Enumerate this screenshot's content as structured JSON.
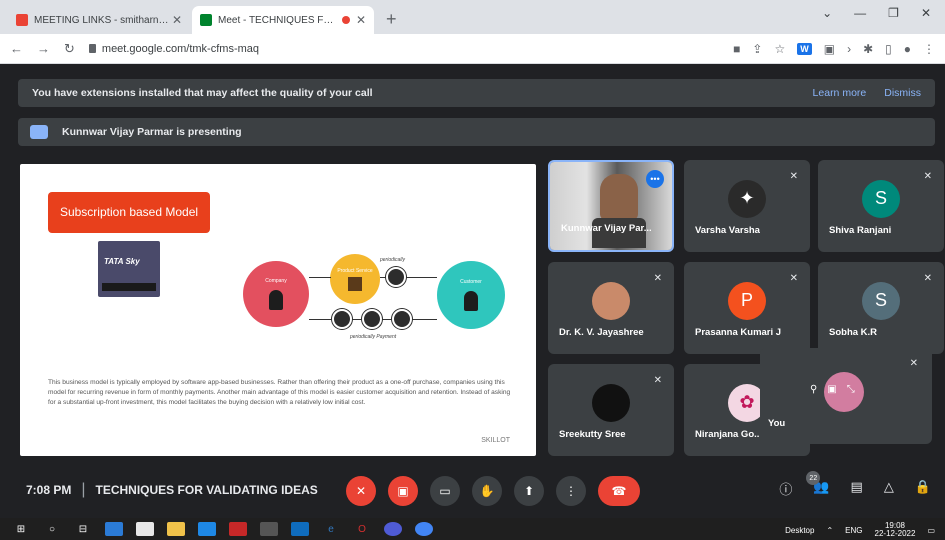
{
  "browser": {
    "tabs": [
      {
        "title": "MEETING LINKS - smitharnair@...",
        "favicon_color": "#ea4335"
      },
      {
        "title": "Meet - TECHNIQUES FOR VA...",
        "favicon_color": "#00832d"
      }
    ],
    "new_tab": "+",
    "url": "meet.google.com/tmk-cfms-maq",
    "ext_label": "W"
  },
  "banner": {
    "message": "You have extensions installed that may affect the quality of your call",
    "learn_more": "Learn more",
    "dismiss": "Dismiss"
  },
  "presenting": {
    "text": "Kunnwar Vijay Parmar is presenting"
  },
  "slide": {
    "title": "Subscription based Model",
    "logo_text": "TATA Sky",
    "company_label": "Company",
    "customer_label": "Customer",
    "product_label": "Product Service",
    "periodically_top": "periodically",
    "periodically_bottom": "periodically Payment",
    "body": "This business model is typically employed by software app-based businesses. Rather than offering their product as a one-off purchase, companies using this model for recurring revenue in form of monthly payments. Another main advantage of this model is easier customer acquisition and retention. Instead of asking for a substantial up-front investment, this model facilitates the buying decision with a relatively low initial cost.",
    "footer": "SKILLOT"
  },
  "participants": [
    {
      "name": "Kunnwar Vijay Par...",
      "type": "video"
    },
    {
      "name": "Varsha Varsha",
      "type": "image",
      "color": "#2a2a2a"
    },
    {
      "name": "Shiva Ranjani",
      "type": "letter",
      "letter": "S",
      "color": "#00897b"
    },
    {
      "name": "Dr. K. V. Jayashree",
      "type": "photo",
      "color": "#c98a6a"
    },
    {
      "name": "Prasanna Kumari J",
      "type": "letter",
      "letter": "P",
      "color": "#f4511e"
    },
    {
      "name": "Sobha K.R",
      "type": "letter",
      "letter": "S",
      "color": "#546e7a"
    },
    {
      "name": "Sreekutty Sree",
      "type": "image",
      "color": "#111111"
    },
    {
      "name": "Niranjana Go...",
      "type": "image",
      "color": "#f3d7e3"
    }
  ],
  "self_tile": {
    "label": "You"
  },
  "bottom": {
    "time": "7:08 PM",
    "separator": "|",
    "meeting_title": "TECHNIQUES FOR VALIDATING IDEAS",
    "people_count": "22"
  },
  "taskbar": {
    "desktop": "Desktop",
    "lang": "ENG",
    "time": "19:08",
    "date": "22-12-2022"
  }
}
